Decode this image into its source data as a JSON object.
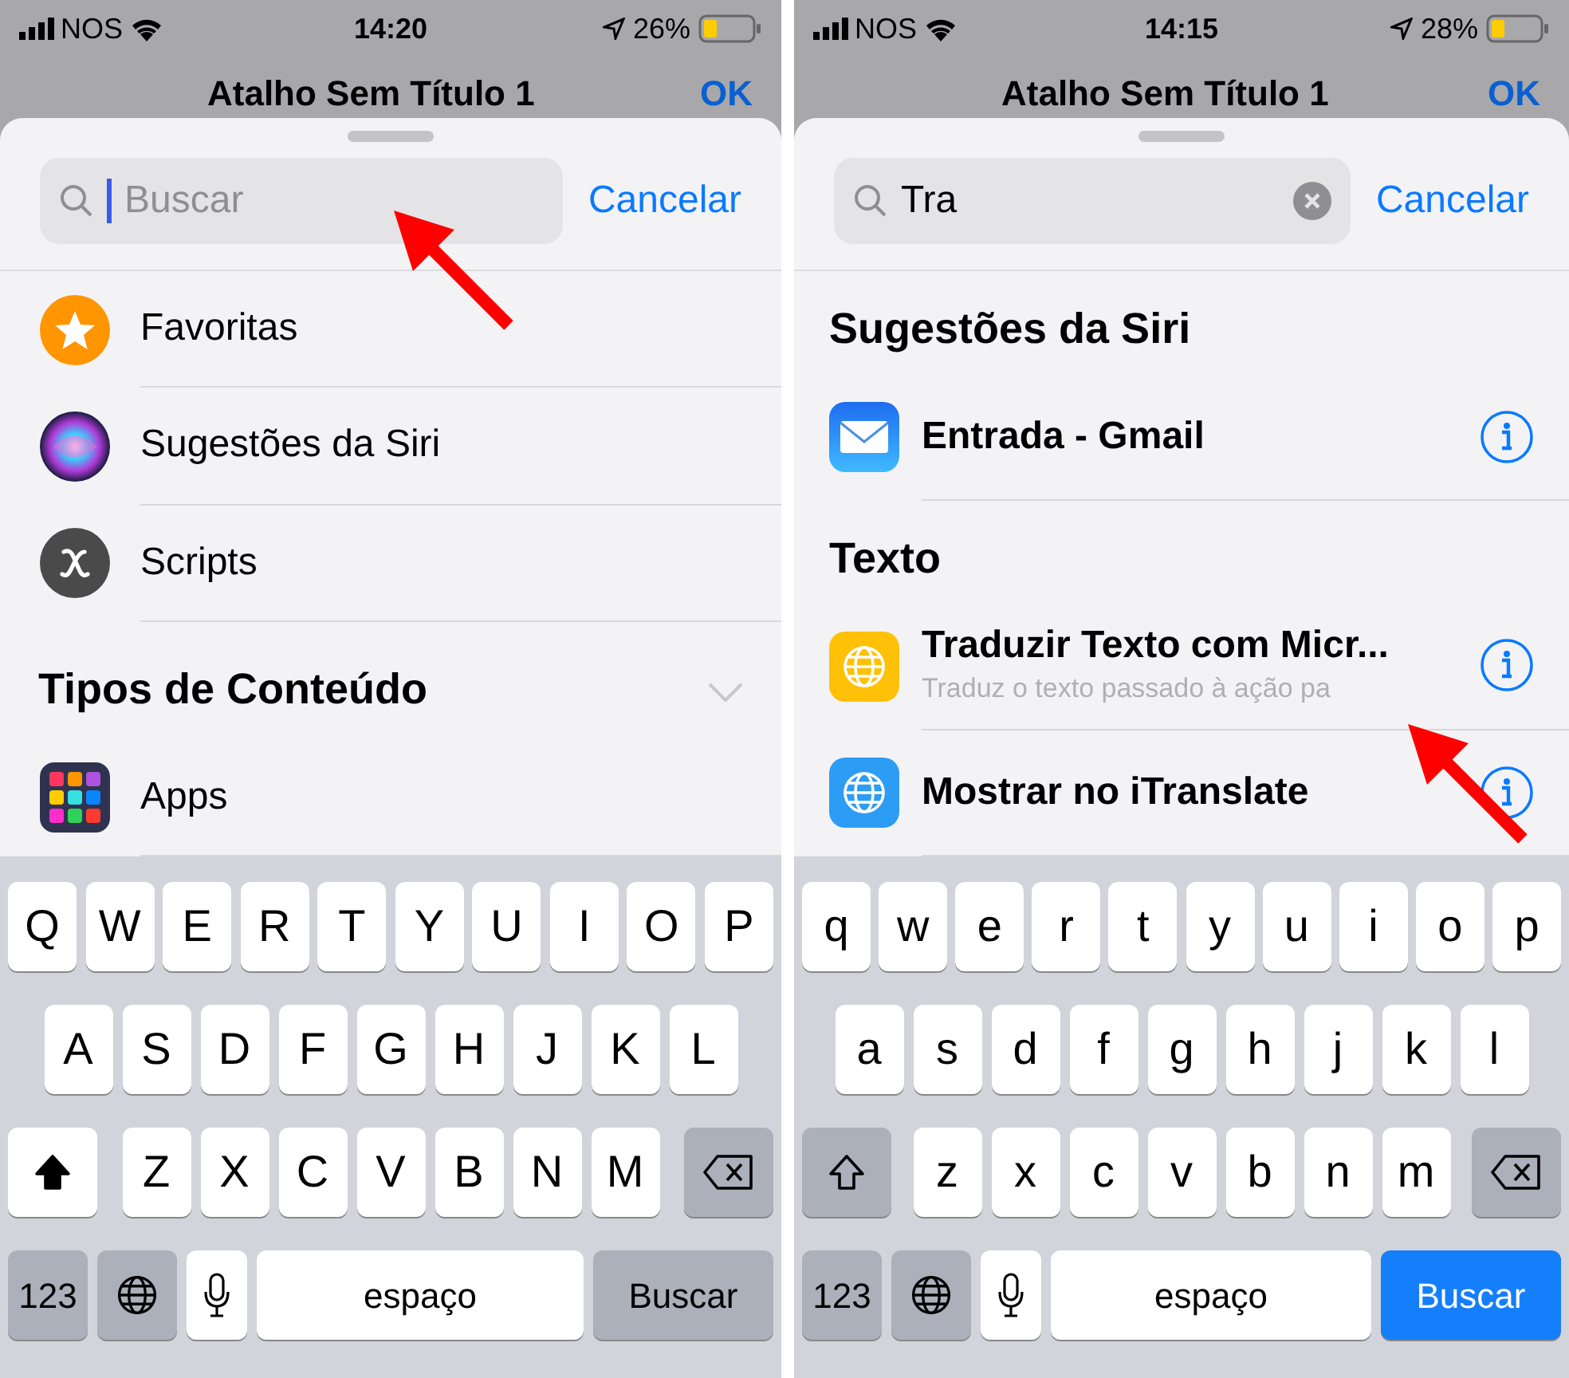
{
  "screens": [
    {
      "status_bar": {
        "carrier": "NOS",
        "time": "14:20",
        "battery": "26%"
      },
      "title": "Atalho Sem Título 1",
      "done": "OK",
      "search": {
        "placeholder": "Buscar",
        "focused": true
      },
      "cancel": "Cancelar",
      "list": [
        {
          "kind": "star",
          "label": "Favoritas"
        },
        {
          "kind": "siri",
          "label": "Sugestões da Siri"
        },
        {
          "kind": "script",
          "label": "Scripts"
        },
        {
          "kind": "section",
          "label": "Tipos de Conteúdo",
          "expanded": false
        },
        {
          "kind": "apps",
          "label": "Apps"
        }
      ],
      "keyboard": {
        "shift": true,
        "letter_rows": [
          [
            "Q",
            "W",
            "E",
            "R",
            "T",
            "Y",
            "U",
            "I",
            "O",
            "P"
          ],
          [
            "A",
            "S",
            "D",
            "F",
            "G",
            "H",
            "J",
            "K",
            "L"
          ],
          [
            "Z",
            "X",
            "C",
            "V",
            "B",
            "N",
            "M"
          ]
        ],
        "numbers_key": "123",
        "space_key": "espaço",
        "return_key": {
          "label": "Buscar",
          "enabled": false
        }
      }
    },
    {
      "status_bar": {
        "carrier": "NOS",
        "time": "14:15",
        "battery": "28%"
      },
      "title": "Atalho Sem Título 1",
      "done": "OK",
      "search": {
        "value": "Tra",
        "focused": false
      },
      "cancel": "Cancelar",
      "list": [
        {
          "kind": "section",
          "label": "Sugestões da Siri"
        },
        {
          "kind": "mail",
          "label": "Entrada - Gmail",
          "info": true
        },
        {
          "kind": "section",
          "label": "Texto"
        },
        {
          "kind": "globe",
          "color": "#ffc107",
          "label": "Traduzir Texto com Micr...",
          "subtitle": "Traduz o texto passado à ação pa",
          "info": true
        },
        {
          "kind": "globe",
          "color": "#2d9cf5",
          "label": "Mostrar no iTranslate",
          "info": true
        }
      ],
      "keyboard": {
        "shift": false,
        "letter_rows": [
          [
            "q",
            "w",
            "e",
            "r",
            "t",
            "y",
            "u",
            "i",
            "o",
            "p"
          ],
          [
            "a",
            "s",
            "d",
            "f",
            "g",
            "h",
            "j",
            "k",
            "l"
          ],
          [
            "z",
            "x",
            "c",
            "v",
            "b",
            "n",
            "m"
          ]
        ],
        "numbers_key": "123",
        "space_key": "espaço",
        "return_key": {
          "label": "Buscar",
          "enabled": true
        }
      }
    }
  ]
}
